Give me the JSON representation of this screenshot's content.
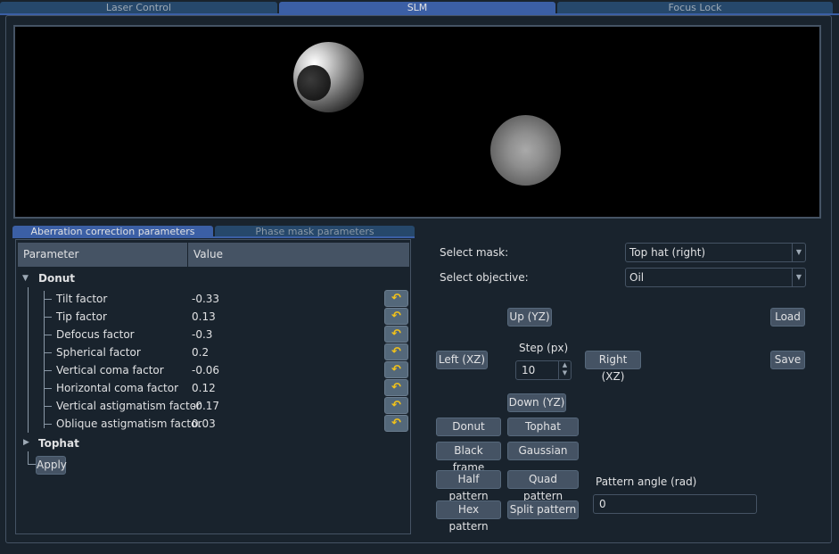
{
  "tabs": [
    "Laser Control",
    "SLM",
    "Focus Lock"
  ],
  "sub_tabs": [
    "Aberration correction parameters",
    "Phase mask parameters"
  ],
  "tree": {
    "col_param": "Parameter",
    "col_value": "Value",
    "group1": "Donut",
    "group2": "Tophat",
    "rows": [
      {
        "label": "Tilt factor",
        "value": "-0.33"
      },
      {
        "label": "Tip factor",
        "value": "0.13"
      },
      {
        "label": "Defocus factor",
        "value": "-0.3"
      },
      {
        "label": "Spherical factor",
        "value": "0.2"
      },
      {
        "label": "Vertical coma factor",
        "value": "-0.06"
      },
      {
        "label": "Horizontal coma factor",
        "value": "0.12"
      },
      {
        "label": "Vertical astigmatism factor",
        "value": "-0.17"
      },
      {
        "label": "Oblique astigmatism factor",
        "value": "0.03"
      }
    ],
    "apply": "Apply",
    "undo_icon": "undo-arrow-icon"
  },
  "controls": {
    "select_mask_label": "Select mask:",
    "select_mask_value": "Top hat (right)",
    "select_objective_label": "Select objective:",
    "select_objective_value": "Oil",
    "up": "Up (YZ)",
    "down": "Down (YZ)",
    "left": "Left (XZ)",
    "right": "Right (XZ)",
    "step_label": "Step (px)",
    "step_value": "10",
    "load": "Load",
    "save": "Save",
    "donut": "Donut",
    "tophat": "Tophat",
    "black_frame": "Black frame",
    "gaussian": "Gaussian",
    "half_pattern": "Half pattern",
    "quad_pattern": "Quad pattern",
    "hex_pattern": "Hex pattern",
    "split_pattern": "Split pattern",
    "pattern_angle_label": "Pattern angle (rad)",
    "pattern_angle_value": "0"
  }
}
